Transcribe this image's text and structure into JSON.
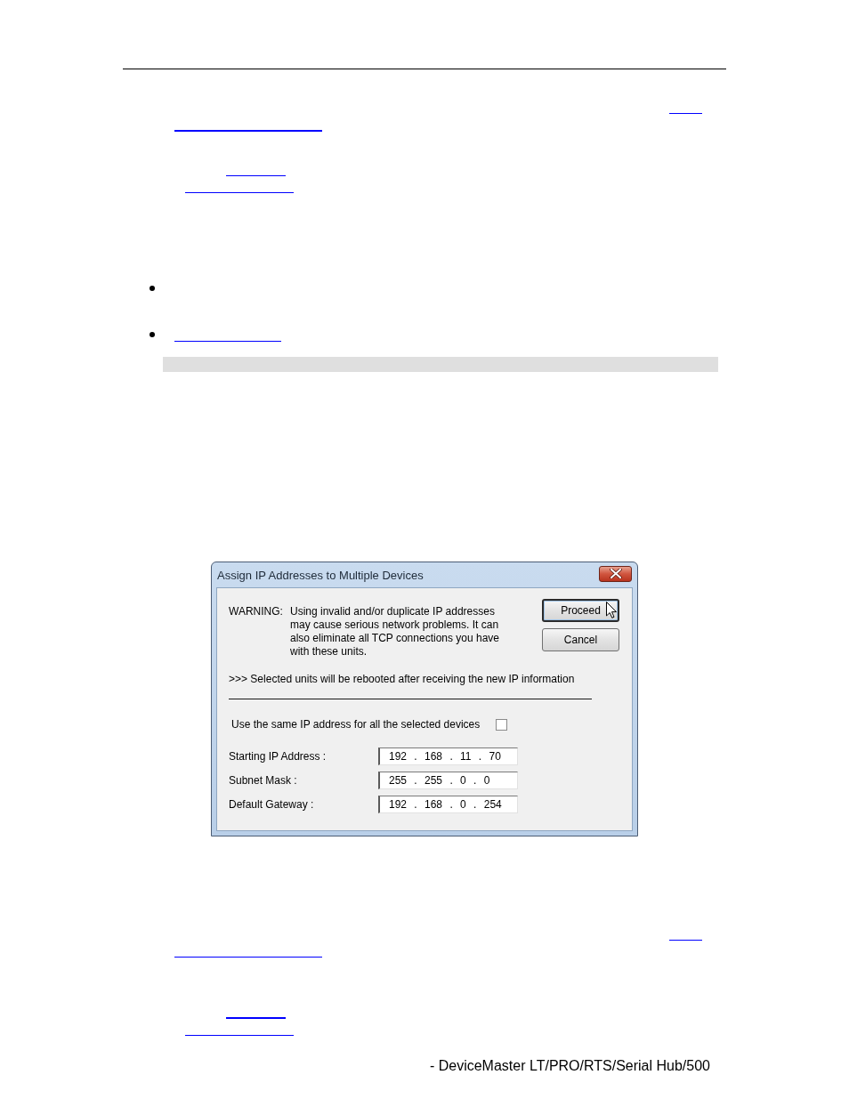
{
  "dialog": {
    "title": "Assign IP Addresses to Multiple Devices",
    "warning": {
      "label": "WARNING:",
      "lines": [
        "Using invalid and/or duplicate IP addresses",
        "may cause serious network problems. It can",
        "also eliminate all TCP connections you have",
        "with these units."
      ]
    },
    "buttons": [
      {
        "label": "Proceed",
        "default": true
      },
      {
        "label": "Cancel",
        "default": false
      }
    ],
    "notice": ">>> Selected units will be rebooted after receiving the new IP information",
    "same_ip_option": {
      "label": "Use the same IP address for all the selected devices",
      "checked": false
    },
    "fields": [
      {
        "label": "Starting IP Address :",
        "value": "192 . 168 . 11 . 70"
      },
      {
        "label": "Subnet Mask :",
        "value": "255 . 255 . 0 . 0"
      },
      {
        "label": "Default Gateway :",
        "value": "192 . 168 . 0 . 254"
      }
    ]
  },
  "footer": {
    "text": "- DeviceMaster LT/PRO/RTS/Serial Hub/500"
  }
}
